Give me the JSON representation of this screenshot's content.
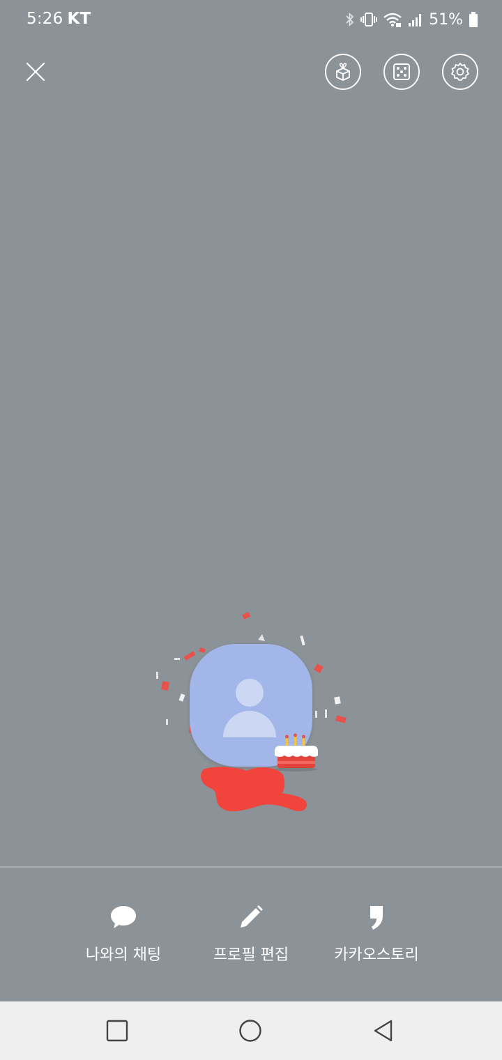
{
  "status_bar": {
    "time": "5:26",
    "carrier": "KT",
    "battery": "51%",
    "icons": [
      "bluetooth-icon",
      "vibrate-icon",
      "wifi-icon",
      "signal-icon",
      "battery-icon"
    ]
  },
  "top_bar": {
    "close_icon": "close-icon",
    "actions": [
      "gift-box-icon",
      "dice-icon",
      "gear-icon"
    ]
  },
  "profile": {
    "avatar_icon": "default-avatar-icon",
    "decoration": "birthday-cake-icon"
  },
  "bottom_actions": [
    {
      "label": "나와의 채팅",
      "icon": "chat-bubble-icon"
    },
    {
      "label": "프로필 편집",
      "icon": "pencil-icon"
    },
    {
      "label": "카카오스토리",
      "icon": "kakaostory-icon"
    }
  ],
  "nav_bar": {
    "buttons": [
      "recent-apps-icon",
      "home-icon",
      "back-icon"
    ]
  },
  "colors": {
    "background": "#8b9298",
    "avatar": "#a3b6e9",
    "nav_bar": "#efefef",
    "confetti": "#e8524a"
  }
}
